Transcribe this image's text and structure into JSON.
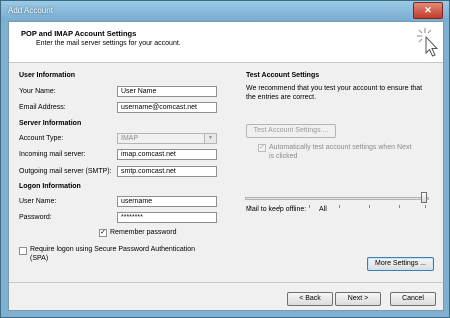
{
  "window": {
    "title": "Add Account",
    "close_symbol": "✕"
  },
  "header": {
    "title": "POP and IMAP Account Settings",
    "subtitle": "Enter the mail server settings for your account."
  },
  "user_info": {
    "heading": "User Information",
    "your_name_label": "Your Name:",
    "your_name_value": "User Name",
    "email_label": "Email Address:",
    "email_value": "username@comcast.net"
  },
  "server_info": {
    "heading": "Server Information",
    "account_type_label": "Account Type:",
    "account_type_value": "IMAP",
    "incoming_label": "Incoming mail server:",
    "incoming_value": "imap.comcast.net",
    "outgoing_label": "Outgoing mail server (SMTP):",
    "outgoing_value": "smtp.comcast.net"
  },
  "logon_info": {
    "heading": "Logon Information",
    "username_label": "User Name:",
    "username_value": "username",
    "password_label": "Password:",
    "password_value": "********",
    "remember_label": "Remember password",
    "remember_checked": true,
    "spa_label_1": "Require logon using Secure Password Authentication",
    "spa_label_2": "(SPA)",
    "spa_checked": false
  },
  "test_settings": {
    "heading": "Test Account Settings",
    "desc_1": "We recommend that you test your account to ensure that",
    "desc_2": "the entries are correct.",
    "test_button": "Test Account Settings ...",
    "auto_label_1": "Automatically test account settings when Next",
    "auto_label_2": "is clicked",
    "auto_checked": true
  },
  "offline": {
    "label": "Mail to keep offline:",
    "value": "All"
  },
  "buttons": {
    "more_settings": "More Settings ...",
    "back": "< Back",
    "next": "Next >",
    "cancel": "Cancel"
  },
  "check_symbol": "✓"
}
